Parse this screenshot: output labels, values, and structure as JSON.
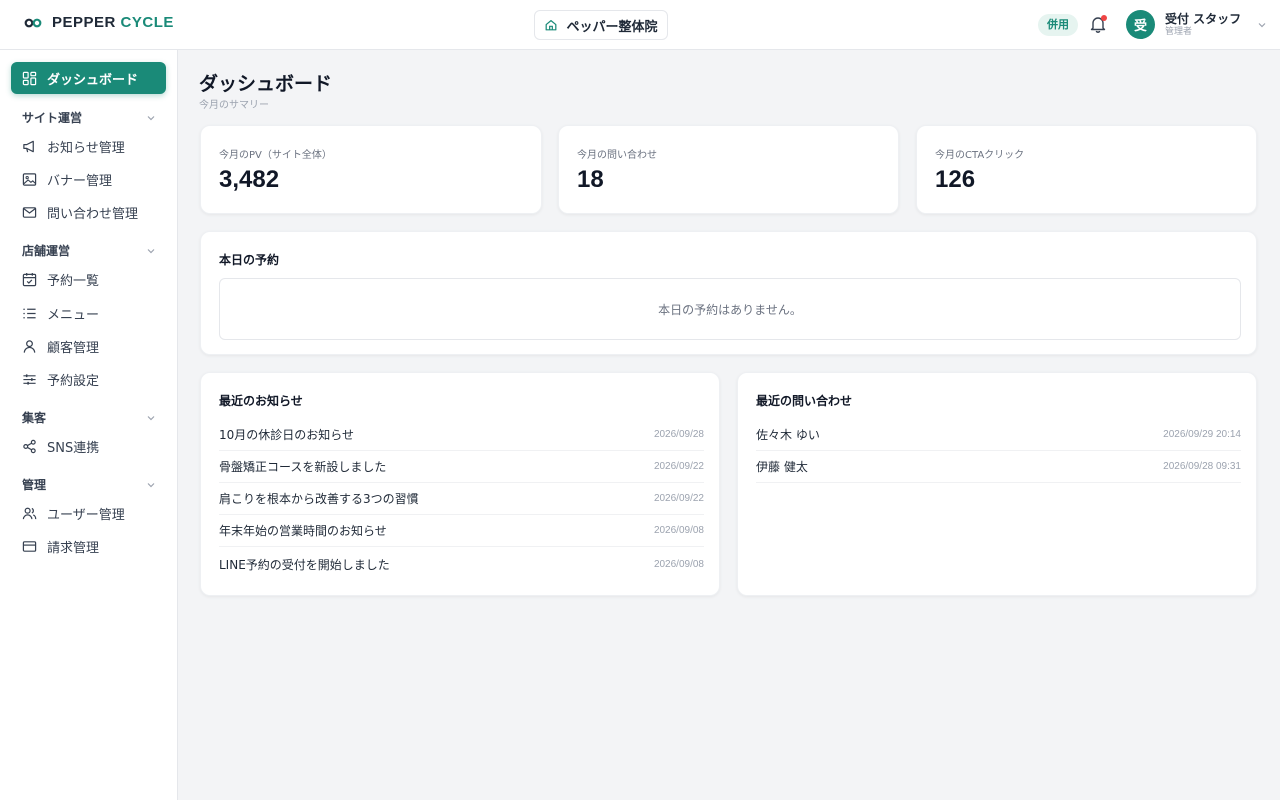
{
  "header": {
    "logo_primary": "PEPPER",
    "logo_accent": "CYCLE",
    "store_name": "ペッパー整体院",
    "badge": "併用",
    "user_name": "受付 スタッフ",
    "user_role": "管理者",
    "avatar_initial": "受"
  },
  "sidebar": {
    "active_item": "ダッシュボード",
    "sections": [
      {
        "title": "サイト運営",
        "items": [
          "お知らせ管理",
          "バナー管理",
          "問い合わせ管理"
        ]
      },
      {
        "title": "店舗運営",
        "items": [
          "予約一覧",
          "メニュー",
          "顧客管理",
          "予約設定"
        ]
      },
      {
        "title": "集客",
        "items": [
          "SNS連携"
        ]
      },
      {
        "title": "管理",
        "items": [
          "ユーザー管理",
          "請求管理"
        ]
      }
    ]
  },
  "main": {
    "title": "ダッシュボード",
    "subtitle": "今月のサマリー",
    "stats": [
      {
        "label": "今月のPV（サイト全体）",
        "value": "3,482"
      },
      {
        "label": "今月の問い合わせ",
        "value": "18"
      },
      {
        "label": "今月のCTAクリック",
        "value": "126"
      }
    ],
    "today": {
      "title": "本日の予約",
      "empty_message": "本日の予約はありません。"
    },
    "news": {
      "title": "最近のお知らせ",
      "items": [
        {
          "title": "10月の休診日のお知らせ",
          "date": "2026/09/28"
        },
        {
          "title": "骨盤矯正コースを新設しました",
          "date": "2026/09/22"
        },
        {
          "title": "肩こりを根本から改善する3つの習慣",
          "date": "2026/09/22"
        },
        {
          "title": "年末年始の営業時間のお知らせ",
          "date": "2026/09/08"
        },
        {
          "title": "LINE予約の受付を開始しました",
          "date": "2026/09/08"
        }
      ]
    },
    "inquiries": {
      "title": "最近の問い合わせ",
      "items": [
        {
          "name": "佐々木 ゆい",
          "date": "2026/09/29 20:14"
        },
        {
          "name": "伊藤 健太",
          "date": "2026/09/28 09:31"
        }
      ]
    }
  },
  "colors": {
    "accent": "#1a8a78",
    "notification": "#ef4444",
    "background": "#f3f4f6"
  }
}
